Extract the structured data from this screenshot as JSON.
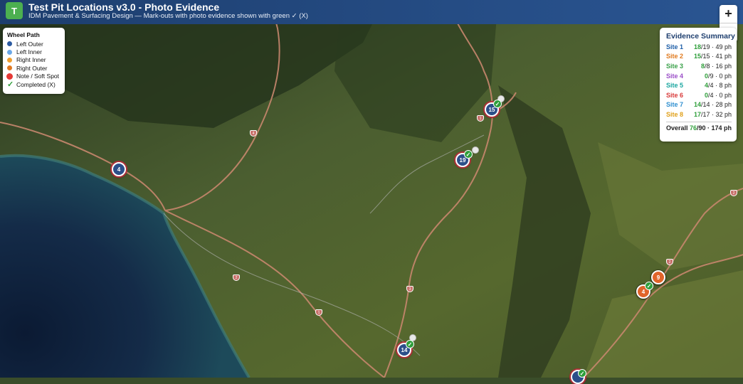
{
  "header": {
    "logo": "T",
    "title": "Test Pit Locations v3.0 - Photo Evidence",
    "subtitle": "IDM Pavement & Surfacing Design — Mark-outs with photo evidence shown with green ✓ (X)"
  },
  "legend": {
    "title": "Wheel Path",
    "items": [
      {
        "label": "Left Outer",
        "color": "#2c5aa0"
      },
      {
        "label": "Left Inner",
        "color": "#6aa8e8"
      },
      {
        "label": "Right Inner",
        "color": "#f0a030"
      },
      {
        "label": "Right Outer",
        "color": "#e07820"
      },
      {
        "label": "Note / Soft Spot",
        "color": "#e53935"
      },
      {
        "label": "Completed (X)",
        "icon": "check-icon"
      }
    ]
  },
  "zoom": {
    "in": "+",
    "out": "−"
  },
  "summary": {
    "title": "Evidence Summary",
    "rows": [
      {
        "site": "Site 1",
        "color": "#1f5fa8",
        "done": "18",
        "rest": "/19 · 49 ph"
      },
      {
        "site": "Site 2",
        "color": "#e07a1f",
        "done": "15",
        "rest": "/15 · 41 ph"
      },
      {
        "site": "Site 3",
        "color": "#3aa14a",
        "done": "8",
        "rest": "/8 · 16 ph"
      },
      {
        "site": "Site 4",
        "color": "#9b4fc8",
        "done": "0",
        "rest": "/9 · 0 ph"
      },
      {
        "site": "Site 5",
        "color": "#1aa6a0",
        "done": "4",
        "rest": "/4 · 8 ph"
      },
      {
        "site": "Site 6",
        "color": "#d83a3a",
        "done": "0",
        "rest": "/4 · 0 ph"
      },
      {
        "site": "Site 7",
        "color": "#2f8fd0",
        "done": "14",
        "rest": "/14 · 28 ph"
      },
      {
        "site": "Site 8",
        "color": "#e0a01a",
        "done": "17",
        "rest": "/17 · 32 ph"
      }
    ],
    "overall_label": "Overall",
    "overall_done": "76",
    "overall_rest": "/90 · 174 ph"
  },
  "markers": [
    {
      "label": "15",
      "style": "blue",
      "check": true
    },
    {
      "label": "19",
      "style": "blue",
      "check": true
    },
    {
      "label": "4",
      "style": "blue",
      "check": false
    },
    {
      "label": "14",
      "style": "blue",
      "check": true
    },
    {
      "label": "9",
      "style": "orange",
      "check": false
    },
    {
      "label": "4",
      "style": "orange",
      "check": true
    }
  ],
  "road_shields": [
    "1",
    "4",
    "1",
    "1",
    "2",
    "3",
    "2",
    "2"
  ],
  "colors": {
    "header": "#1d3e6e",
    "completed": "#2e9e3a"
  }
}
